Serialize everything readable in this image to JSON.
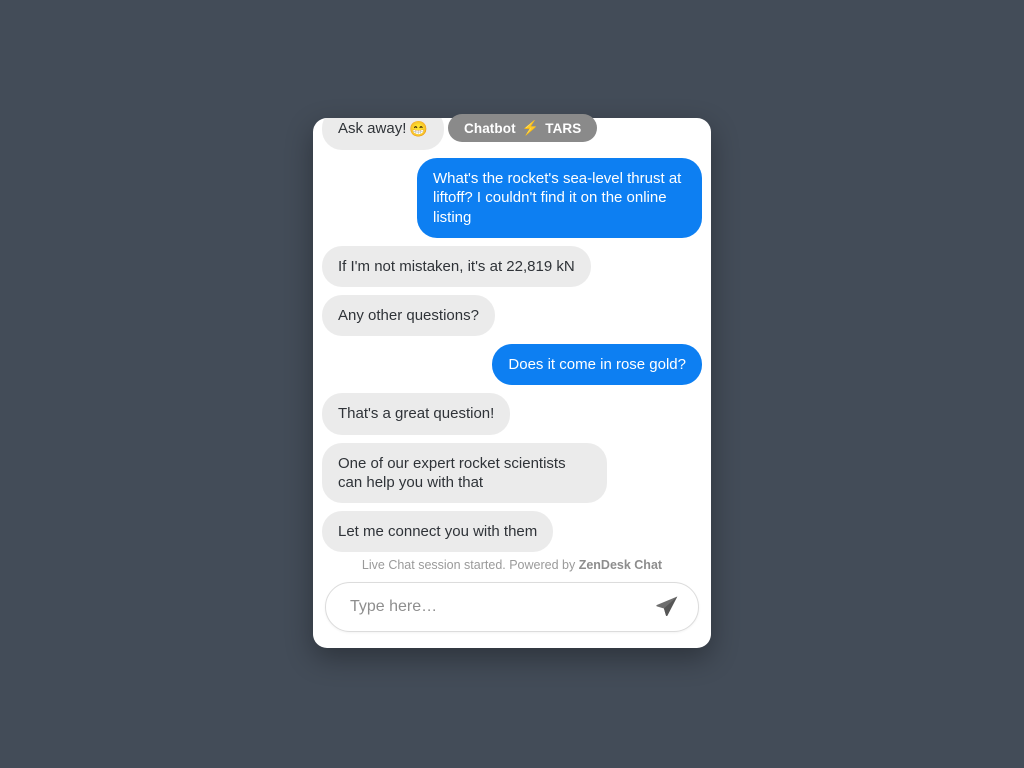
{
  "badge": {
    "prefix": "Chatbot",
    "bolt_icon": "⚡",
    "name": "TARS"
  },
  "messages": [
    {
      "sender": "bot",
      "text": "Ask away!",
      "emoji": "😁",
      "clipped": true
    },
    {
      "sender": "user",
      "text": "What's the rocket's sea-level thrust at liftoff? I couldn't find it on the online listing"
    },
    {
      "sender": "bot",
      "text": "If I'm not mistaken, it's at 22,819 kN"
    },
    {
      "sender": "bot",
      "text": "Any other questions?"
    },
    {
      "sender": "user",
      "text": "Does it come in rose gold?"
    },
    {
      "sender": "bot",
      "text": "That's a great question!"
    },
    {
      "sender": "bot",
      "text": "One of our expert rocket scientists can help you with that"
    },
    {
      "sender": "bot",
      "text": "Let me connect you with them"
    }
  ],
  "session_note": {
    "text": "Live Chat session started. Powered by ",
    "brand": "ZenDesk Chat"
  },
  "composer": {
    "placeholder": "Type here…",
    "value": "",
    "send_label": "Send"
  },
  "colors": {
    "page_background": "#434c58",
    "user_bubble": "#0d7ff2",
    "bot_bubble": "#ebebeb",
    "badge": "#8a8a8a",
    "bolt": "#f5c518",
    "card": "#ffffff"
  }
}
